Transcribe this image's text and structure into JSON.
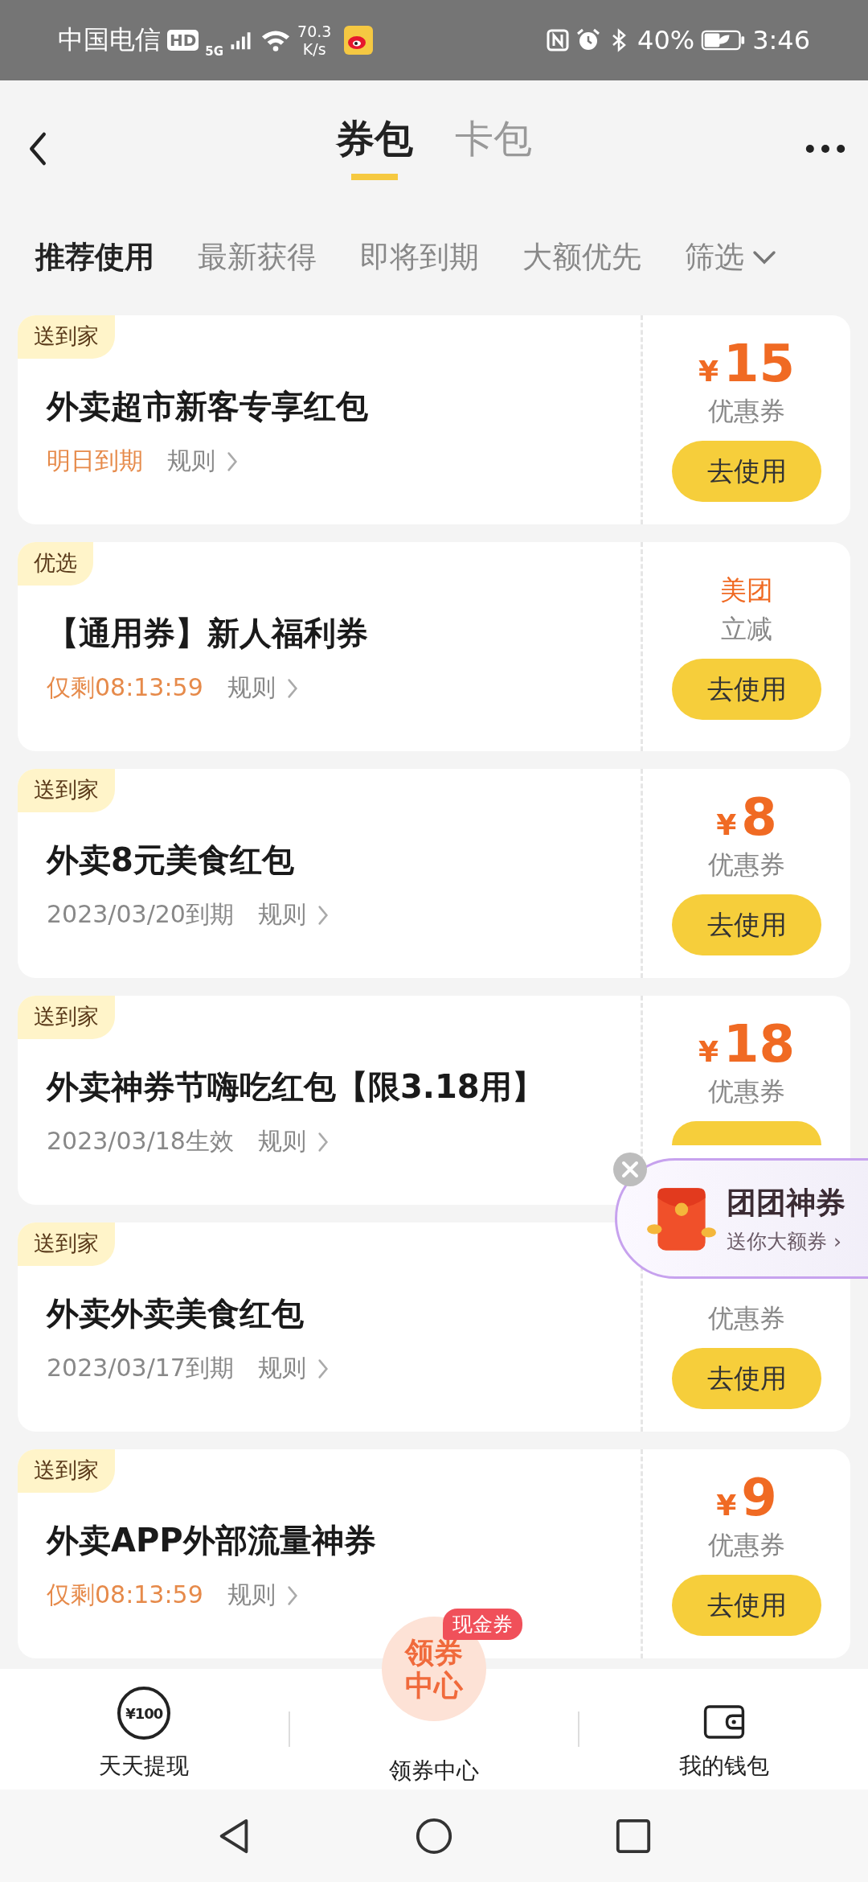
{
  "status_bar": {
    "carrier": "中国电信",
    "hd": "HD",
    "network": "5G",
    "speed_value": "70.3",
    "speed_unit": "K/s",
    "battery": "40%",
    "time": "3:46"
  },
  "header": {
    "tabs": [
      {
        "label": "券包",
        "selected": true
      },
      {
        "label": "卡包",
        "selected": false
      }
    ]
  },
  "filters": [
    {
      "label": "推荐使用",
      "selected": true
    },
    {
      "label": "最新获得",
      "selected": false
    },
    {
      "label": "即将到期",
      "selected": false
    },
    {
      "label": "大额优先",
      "selected": false
    }
  ],
  "filter_menu": "筛选",
  "coupons": [
    {
      "tag": "送到家",
      "title": "外卖超市新客专享红包",
      "expiry": "明日到期",
      "urgent": true,
      "rules": "规则",
      "right": {
        "kind": "amount",
        "currency": "¥",
        "value": "15",
        "label": "优惠券"
      },
      "button": "去使用"
    },
    {
      "tag": "优选",
      "title": "【通用券】新人福利券",
      "expiry": "仅剩08:13:59",
      "urgent": true,
      "rules": "规则",
      "right": {
        "kind": "brand",
        "brand": "美团",
        "label": "立减"
      },
      "button": "去使用"
    },
    {
      "tag": "送到家",
      "title": "外卖8元美食红包",
      "expiry": "2023/03/20到期",
      "urgent": false,
      "rules": "规则",
      "right": {
        "kind": "amount",
        "currency": "¥",
        "value": "8",
        "label": "优惠券"
      },
      "button": "去使用"
    },
    {
      "tag": "送到家",
      "title": "外卖神券节嗨吃红包【限3.18用】",
      "expiry": "2023/03/18生效",
      "urgent": false,
      "rules": "规则",
      "right": {
        "kind": "amount",
        "currency": "¥",
        "value": "18",
        "label": "优惠券"
      }
    },
    {
      "tag": "送到家",
      "title": "外卖外卖美食红包",
      "expiry": "2023/03/17到期",
      "urgent": false,
      "rules": "规则",
      "right": {
        "kind": "amount",
        "label": "优惠券"
      },
      "button": "去使用"
    },
    {
      "tag": "送到家",
      "title": "外卖APP外部流量神券",
      "expiry": "仅剩08:13:59",
      "urgent": true,
      "rules": "规则",
      "right": {
        "kind": "amount",
        "currency": "¥",
        "value": "9",
        "label": "优惠券"
      },
      "button": "去使用"
    }
  ],
  "promo": {
    "title": "团团神券",
    "subtitle": "送你大额券 ›"
  },
  "bottom_nav": [
    {
      "kind": "cash",
      "icon_text": "¥100",
      "label": "天天提现"
    },
    {
      "kind": "center",
      "icon_text": "领券中心",
      "badge": "现金券",
      "label": "领券中心"
    },
    {
      "kind": "wallet",
      "label": "我的钱包"
    }
  ]
}
